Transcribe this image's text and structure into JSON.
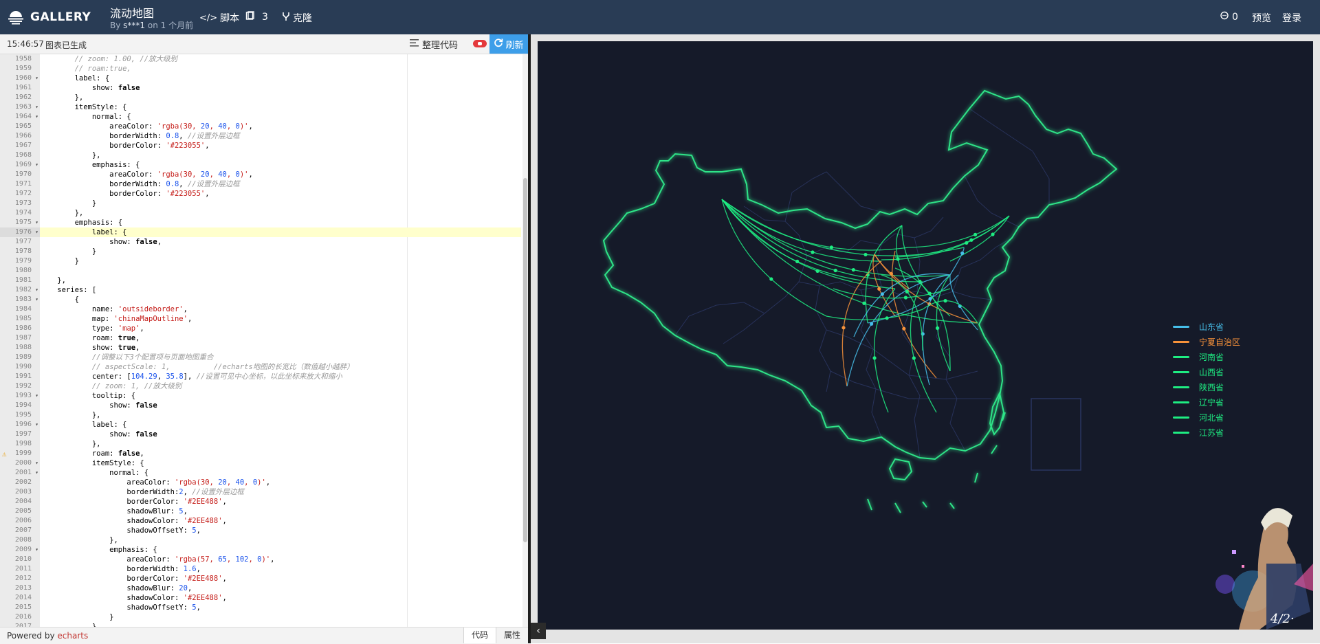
{
  "header": {
    "logo_text": "GALLERY",
    "title": "流动地图",
    "by_prefix": "By",
    "author": "s***1",
    "time_text": "on 1 个月前",
    "nav_script": "脚本",
    "nav_count": "3",
    "nav_clone": "克隆",
    "comments_count": "0",
    "preview_label": "预览",
    "login_label": "登录"
  },
  "editor": {
    "time": "15:46:57",
    "status": "图表已生成",
    "format_label": "整理代码",
    "refresh_label": "刷新",
    "powered_prefix": "Powered by",
    "powered_link": "echarts",
    "tab_code": "代码",
    "tab_props": "属性",
    "active_line": "1976",
    "warning_line": "1999",
    "line_numbers": [
      "1958",
      "1959",
      "1960",
      "1961",
      "1962",
      "1963",
      "1964",
      "1965",
      "1966",
      "1967",
      "1968",
      "1969",
      "1970",
      "1971",
      "1972",
      "1973",
      "1974",
      "1975",
      "1976",
      "1977",
      "1978",
      "1979",
      "1980",
      "1981",
      "1982",
      "1983",
      "1984",
      "1985",
      "1986",
      "1987",
      "1988",
      "1989",
      "1990",
      "1991",
      "1992",
      "1993",
      "1994",
      "1995",
      "1996",
      "1997",
      "1998",
      "1999",
      "2000",
      "2001",
      "2002",
      "2003",
      "2004",
      "2005",
      "2006",
      "2007",
      "2008",
      "2009",
      "2010",
      "2011",
      "2012",
      "2013",
      "2014",
      "2015",
      "2016",
      "2017"
    ],
    "fold_lines": [
      "1960",
      "1963",
      "1964",
      "1969",
      "1975",
      "1976",
      "1982",
      "1983",
      "1993",
      "1996",
      "2000",
      "2001",
      "2009"
    ],
    "code_lines": [
      "        // zoom: 1.00, //放大级别",
      "        // roam:true,",
      "        label: {",
      "            show: false",
      "        },",
      "        itemStyle: {",
      "            normal: {",
      "                areaColor: 'rgba(30, 20, 40, 0)',",
      "                borderWidth: 0.8, //设置外层边框",
      "                borderColor: '#223055',",
      "            },",
      "            emphasis: {",
      "                areaColor: 'rgba(30, 20, 40, 0)',",
      "                borderWidth: 0.8, //设置外层边框",
      "                borderColor: '#223055',",
      "            }",
      "        },",
      "        emphasis: {",
      "            label: {",
      "                show: false,",
      "            }",
      "        }",
      "",
      "    },",
      "    series: [",
      "        {",
      "            name: 'outsideborder',",
      "            map: 'chinaMapOutline',",
      "            type: 'map',",
      "            roam: true,",
      "            show: true,",
      "            //调整以下3个配置项与页面地图重合",
      "            // aspectScale: 1,          //echarts地图的长宽比（数值越小越胖）",
      "            center: [104.29, 35.8], //设置可见中心坐标，以此坐标来放大和缩小",
      "            // zoom: 1, //放大级别",
      "            tooltip: {",
      "                show: false",
      "            },",
      "            label: {",
      "                show: false",
      "            },",
      "            roam: false,",
      "            itemStyle: {",
      "                normal: {",
      "                    areaColor: 'rgba(30, 20, 40, 0)',",
      "                    borderWidth:2, //设置外层边框",
      "                    borderColor: '#2EE488',",
      "                    shadowBlur: 5,",
      "                    shadowColor: '#2EE488',",
      "                    shadowOffsetY: 5,",
      "                },",
      "                emphasis: {",
      "                    areaColor: 'rgba(57, 65, 102, 0)',",
      "                    borderWidth: 1.6,",
      "                    borderColor: '#2EE488',",
      "                    shadowBlur: 20,",
      "                    shadowColor: '#2EE488',",
      "                    shadowOffsetY: 5,",
      "                }",
      "            },"
    ]
  },
  "chart_data": {
    "type": "flow-map",
    "background": "#151a29",
    "map_border_color": "#2EE488",
    "inner_border_color": "#223055",
    "legend_placement": "right",
    "legend": [
      {
        "name": "山东省",
        "color": "#46bee9"
      },
      {
        "name": "宁夏自治区",
        "color": "#f7923a"
      },
      {
        "name": "河南省",
        "color": "#1eed82"
      },
      {
        "name": "山西省",
        "color": "#1eed82"
      },
      {
        "name": "陕西省",
        "color": "#1eed82"
      },
      {
        "name": "辽宁省",
        "color": "#1eed82"
      },
      {
        "name": "河北省",
        "color": "#1eed82"
      },
      {
        "name": "江苏省",
        "color": "#1eed82"
      }
    ]
  },
  "icons": {
    "logo": "gallery-logo-icon",
    "script": "code-icon",
    "count": "book-icon",
    "clone": "fork-icon",
    "comments": "comment-icon",
    "format": "format-lines-icon",
    "refresh": "refresh-icon",
    "collapse": "chevron-left-icon"
  }
}
